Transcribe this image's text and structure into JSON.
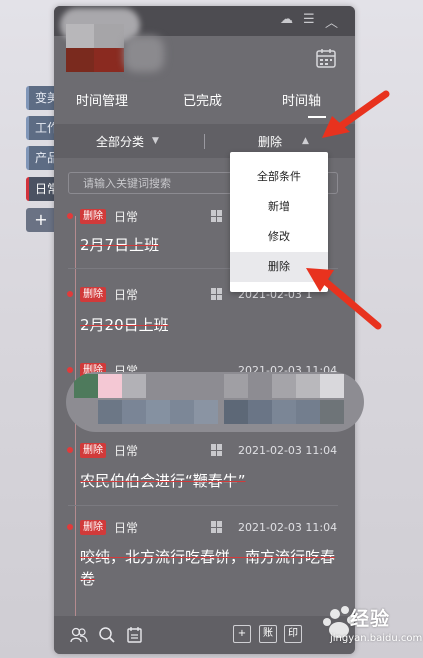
{
  "side_tabs": [
    {
      "label": "变美"
    },
    {
      "label": "工作"
    },
    {
      "label": "产品"
    },
    {
      "label": "日常"
    }
  ],
  "side_add_label": "+",
  "tabs": [
    {
      "label": "时间管理"
    },
    {
      "label": "已完成"
    },
    {
      "label": "时间轴",
      "active": true
    }
  ],
  "filter": {
    "category_label": "全部分类",
    "action_label": "删除"
  },
  "search": {
    "placeholder": "请输入关键词搜索"
  },
  "dropdown": [
    {
      "label": "全部条件"
    },
    {
      "label": "新增"
    },
    {
      "label": "修改"
    },
    {
      "label": "删除",
      "highlighted": true
    }
  ],
  "items": [
    {
      "tag": "删除",
      "category": "日常",
      "date": "",
      "title": "2月7日上班"
    },
    {
      "tag": "删除",
      "category": "日常",
      "date": "2021-02-03 1",
      "title": "2月20日上班"
    },
    {
      "tag": "删除",
      "category": "日常",
      "date": "2021-02-03 11:04",
      "title": ""
    },
    {
      "tag": "删除",
      "category": "日常",
      "date": "2021-02-03 11:04",
      "title": "农民伯伯会进行“鞭春牛”"
    },
    {
      "tag": "删除",
      "category": "日常",
      "date": "2021-02-03 11:04",
      "title": "咬纯，北方流行吃春饼，南方流行吃春卷"
    }
  ],
  "footer": {
    "add_btn": "+",
    "account_btn": "账",
    "print_btn": "印"
  },
  "watermark": {
    "brand": "经验",
    "url": "jingyan.baidu.com"
  },
  "colors": {
    "panel": "#6d6c71",
    "accent_red": "#d13a3a",
    "arrow_red": "#e8321e"
  }
}
